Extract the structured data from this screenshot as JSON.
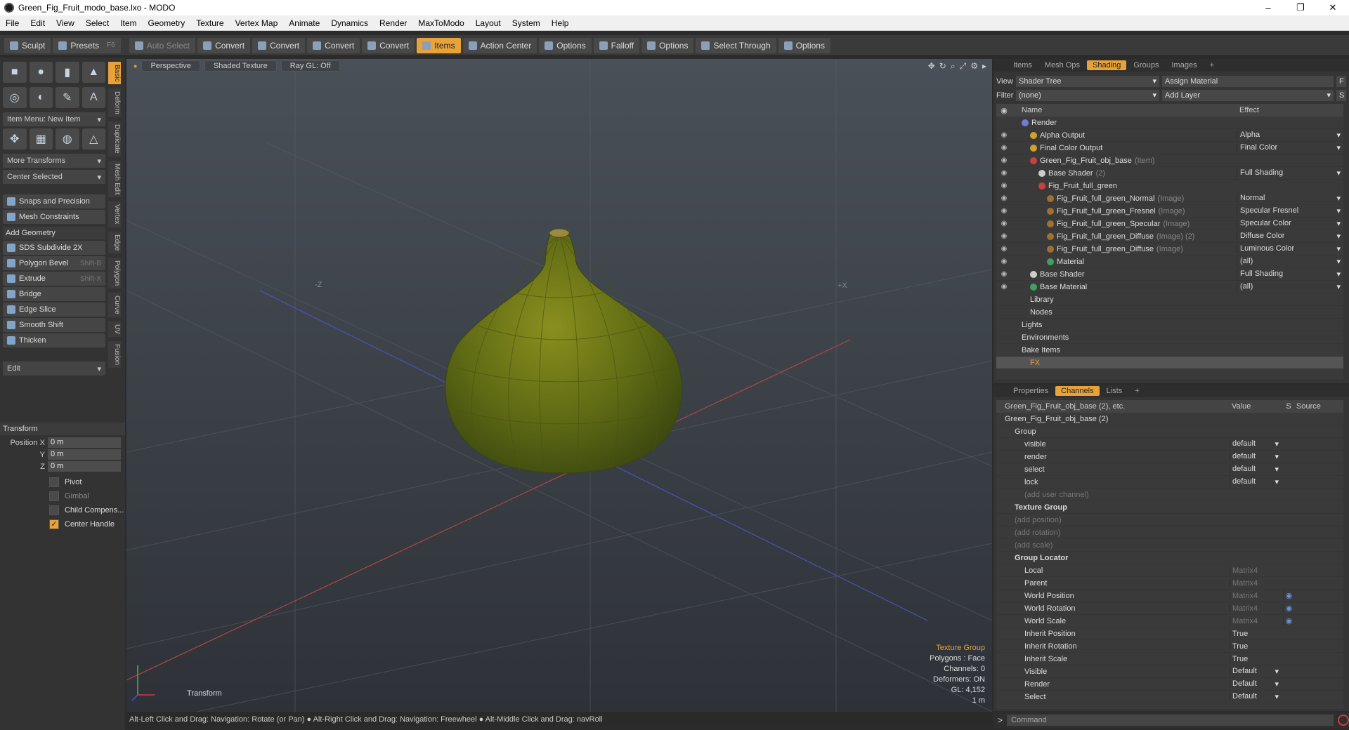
{
  "window": {
    "title": "Green_Fig_Fruit_modo_base.lxo - MODO",
    "minimize": "–",
    "maximize": "❐",
    "close": "✕"
  },
  "menu": [
    "File",
    "Edit",
    "View",
    "Select",
    "Item",
    "Geometry",
    "Texture",
    "Vertex Map",
    "Animate",
    "Dynamics",
    "Render",
    "MaxToModo",
    "Layout",
    "System",
    "Help"
  ],
  "toolbar": {
    "sculpt": "Sculpt",
    "presets": "Presets",
    "presets_key": "F6",
    "auto_select": "Auto Select",
    "convert1": "Convert",
    "convert2": "Convert",
    "convert3": "Convert",
    "convert4": "Convert",
    "items": "Items",
    "action_center": "Action Center",
    "options1": "Options",
    "falloff": "Falloff",
    "options2": "Options",
    "select_through": "Select Through",
    "options3": "Options"
  },
  "left": {
    "item_menu": "Item Menu: New Item",
    "more_transforms": "More Transforms",
    "center_selected": "Center Selected",
    "snaps": "Snaps and Precision",
    "mesh_constraints": "Mesh Constraints",
    "add_geometry": "Add Geometry",
    "tools": [
      {
        "label": "SDS Subdivide 2X",
        "key": ""
      },
      {
        "label": "Polygon Bevel",
        "key": "Shift-B"
      },
      {
        "label": "Extrude",
        "key": "Shift-X"
      },
      {
        "label": "Bridge",
        "key": ""
      },
      {
        "label": "Edge Slice",
        "key": ""
      },
      {
        "label": "Smooth Shift",
        "key": ""
      },
      {
        "label": "Thicken",
        "key": ""
      }
    ],
    "edit": "Edit",
    "vtabs": [
      "Basic",
      "Deform",
      "Duplicate",
      "Mesh Edit",
      "Vertex",
      "Edge",
      "Polygon",
      "Curve",
      "UV",
      "Fusion"
    ],
    "transform": "Transform",
    "pos_x_label": "Position X",
    "y_label": "Y",
    "z_label": "Z",
    "pos_x": "0 m",
    "pos_y": "0 m",
    "pos_z": "0 m",
    "pivot": "Pivot",
    "gimbal": "Gimbal",
    "child_comp": "Child Compens...",
    "center_handle": "Center Handle"
  },
  "viewport": {
    "perspective": "Perspective",
    "shaded": "Shaded Texture",
    "raygl": "Ray GL: Off",
    "axis_neg_z": "-Z",
    "axis_pos_x": "+X",
    "transform_label": "Transform",
    "hud": [
      "Texture Group",
      "Polygons : Face",
      "Channels: 0",
      "Deformers: ON",
      "GL: 4,152",
      "1 m"
    ]
  },
  "status": "Alt-Left Click and Drag: Navigation: Rotate (or Pan) ●  Alt-Right Click and Drag: Navigation: Freewheel ●  Alt-Middle Click and Drag: navRoll",
  "shading": {
    "tabs": [
      "Items",
      "Mesh Ops",
      "Shading",
      "Groups",
      "Images"
    ],
    "view_label": "View",
    "view_value": "Shader Tree",
    "assign_material": "Assign Material",
    "f_btn": "F",
    "filter_label": "Filter",
    "filter_value": "(none)",
    "add_layer": "Add Layer",
    "s_btn": "S",
    "col_name": "Name",
    "col_effect": "Effect",
    "rows": [
      {
        "name": "Render",
        "sub": "",
        "effect": "",
        "indent": 0,
        "color": "#6b7fd6"
      },
      {
        "name": "Alpha Output",
        "sub": "",
        "effect": "Alpha",
        "indent": 1,
        "color": "#d0a030"
      },
      {
        "name": "Final Color Output",
        "sub": "",
        "effect": "Final Color",
        "indent": 1,
        "color": "#d0a030"
      },
      {
        "name": "Green_Fig_Fruit_obj_base",
        "sub": "(Item)",
        "effect": "",
        "indent": 1,
        "color": "#c84040"
      },
      {
        "name": "Base Shader",
        "sub": "(2)",
        "effect": "Full Shading",
        "indent": 2,
        "color": "#cccccc"
      },
      {
        "name": "Fig_Fruit_full_green",
        "sub": "",
        "effect": "",
        "indent": 2,
        "color": "#c84040"
      },
      {
        "name": "Fig_Fruit_full_green_Normal",
        "sub": "(Image)",
        "effect": "Normal",
        "indent": 3,
        "color": "#a07030"
      },
      {
        "name": "Fig_Fruit_full_green_Fresnel",
        "sub": "(Image)",
        "effect": "Specular Fresnel",
        "indent": 3,
        "color": "#a07030"
      },
      {
        "name": "Fig_Fruit_full_green_Specular",
        "sub": "(Image)",
        "effect": "Specular Color",
        "indent": 3,
        "color": "#a07030"
      },
      {
        "name": "Fig_Fruit_full_green_Diffuse",
        "sub": "(Image) (2)",
        "effect": "Diffuse Color",
        "indent": 3,
        "color": "#a07030"
      },
      {
        "name": "Fig_Fruit_full_green_Diffuse",
        "sub": "(Image)",
        "effect": "Luminous Color",
        "indent": 3,
        "color": "#a07030"
      },
      {
        "name": "Material",
        "sub": "",
        "effect": "(all)",
        "indent": 3,
        "color": "#40a060"
      },
      {
        "name": "Base Shader",
        "sub": "",
        "effect": "Full Shading",
        "indent": 1,
        "color": "#cccccc"
      },
      {
        "name": "Base Material",
        "sub": "",
        "effect": "(all)",
        "indent": 1,
        "color": "#40a060"
      },
      {
        "name": "Library",
        "sub": "",
        "effect": "",
        "indent": 1,
        "color": ""
      },
      {
        "name": "Nodes",
        "sub": "",
        "effect": "",
        "indent": 1,
        "color": ""
      },
      {
        "name": "Lights",
        "sub": "",
        "effect": "",
        "indent": 0,
        "color": ""
      },
      {
        "name": "Environments",
        "sub": "",
        "effect": "",
        "indent": 0,
        "color": ""
      },
      {
        "name": "Bake Items",
        "sub": "",
        "effect": "",
        "indent": 0,
        "color": ""
      },
      {
        "name": "FX",
        "sub": "",
        "effect": "",
        "indent": 1,
        "color": ""
      }
    ]
  },
  "channels": {
    "tabs": [
      "Properties",
      "Channels",
      "Lists"
    ],
    "col_name": "Green_Fig_Fruit_obj_base (2), etc.",
    "col_value": "Value",
    "col_s": "S",
    "col_source": "Source",
    "rows": [
      {
        "name": "Green_Fig_Fruit_obj_base (2)",
        "value": "",
        "indent": 0,
        "style": ""
      },
      {
        "name": "Group",
        "value": "",
        "indent": 1,
        "style": ""
      },
      {
        "name": "visible",
        "value": "default",
        "indent": 2,
        "style": ""
      },
      {
        "name": "render",
        "value": "default",
        "indent": 2,
        "style": ""
      },
      {
        "name": "select",
        "value": "default",
        "indent": 2,
        "style": ""
      },
      {
        "name": "lock",
        "value": "default",
        "indent": 2,
        "style": ""
      },
      {
        "name": "(add user channel)",
        "value": "",
        "indent": 2,
        "style": "dim"
      },
      {
        "name": "Texture Group",
        "value": "",
        "indent": 1,
        "style": "bold"
      },
      {
        "name": "(add position)",
        "value": "",
        "indent": 1,
        "style": "dim"
      },
      {
        "name": "(add rotation)",
        "value": "",
        "indent": 1,
        "style": "dim"
      },
      {
        "name": "(add scale)",
        "value": "",
        "indent": 1,
        "style": "dim"
      },
      {
        "name": "Group Locator",
        "value": "",
        "indent": 1,
        "style": "bold"
      },
      {
        "name": "Local",
        "value": "Matrix4",
        "indent": 2,
        "style": "mtx"
      },
      {
        "name": "Parent",
        "value": "Matrix4",
        "indent": 2,
        "style": "mtx"
      },
      {
        "name": "World Position",
        "value": "Matrix4",
        "indent": 2,
        "style": "mtx"
      },
      {
        "name": "World Rotation",
        "value": "Matrix4",
        "indent": 2,
        "style": "mtx"
      },
      {
        "name": "World Scale",
        "value": "Matrix4",
        "indent": 2,
        "style": "mtx"
      },
      {
        "name": "Inherit Position",
        "value": "True",
        "indent": 2,
        "style": ""
      },
      {
        "name": "Inherit Rotation",
        "value": "True",
        "indent": 2,
        "style": ""
      },
      {
        "name": "Inherit Scale",
        "value": "True",
        "indent": 2,
        "style": ""
      },
      {
        "name": "Visible",
        "value": "Default",
        "indent": 2,
        "style": ""
      },
      {
        "name": "Render",
        "value": "Default",
        "indent": 2,
        "style": ""
      },
      {
        "name": "Select",
        "value": "Default",
        "indent": 2,
        "style": ""
      }
    ]
  },
  "command_placeholder": "Command",
  "colors": {
    "accent": "#e8a23a"
  }
}
